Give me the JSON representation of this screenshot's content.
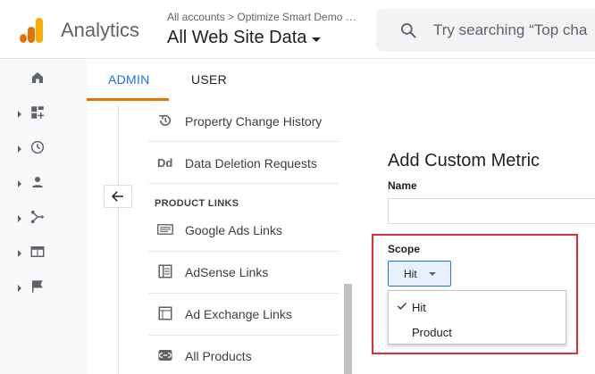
{
  "header": {
    "app_title": "Analytics",
    "breadcrumb": "All accounts > Optimize Smart Demo …",
    "property": "All Web Site Data",
    "search_placeholder": "Try searching “Top cha"
  },
  "rail": {
    "items": [
      "home",
      "customization",
      "realtime",
      "audience",
      "acquisition",
      "behavior",
      "conversions"
    ]
  },
  "tabs": {
    "admin": "ADMIN",
    "user": "USER"
  },
  "admin_menu": {
    "property_change_history": "Property Change History",
    "data_deletion_icon": "Dd",
    "data_deletion_requests": "Data Deletion Requests",
    "section_product_links": "PRODUCT LINKS",
    "google_ads_links": "Google Ads Links",
    "adsense_links": "AdSense Links",
    "ad_exchange_links": "Ad Exchange Links",
    "all_products": "All Products"
  },
  "form": {
    "title": "Add Custom Metric",
    "name_label": "Name",
    "name_value": "",
    "scope_label": "Scope",
    "scope_selected": "Hit",
    "scope_options": [
      "Hit",
      "Product"
    ]
  },
  "colors": {
    "accent": "#1a73e8",
    "tab_underline": "#e37400",
    "highlight": "#e32f2f"
  }
}
